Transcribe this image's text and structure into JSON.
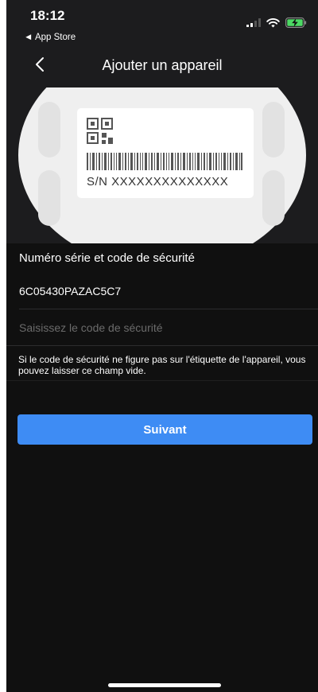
{
  "status_bar": {
    "time": "18:12",
    "back_app": "◄ App Store"
  },
  "nav": {
    "title": "Ajouter un appareil"
  },
  "illustration": {
    "sn_label": "S/N  XXXXXXXXXXXXXX"
  },
  "form": {
    "section_title": "Numéro série et code de sécurité",
    "serial_value": "6C05430PAZAC5C7",
    "code_placeholder": "Saisissez le code de sécurité",
    "hint": "Si le code de sécurité ne figure pas sur l'étiquette de l'appareil, vous pouvez laisser ce champ vide."
  },
  "actions": {
    "next_label": "Suivant"
  },
  "colors": {
    "accent": "#3e8cf4",
    "background": "#101010",
    "header_background": "#1c1c1e",
    "battery": "#4cd964"
  }
}
